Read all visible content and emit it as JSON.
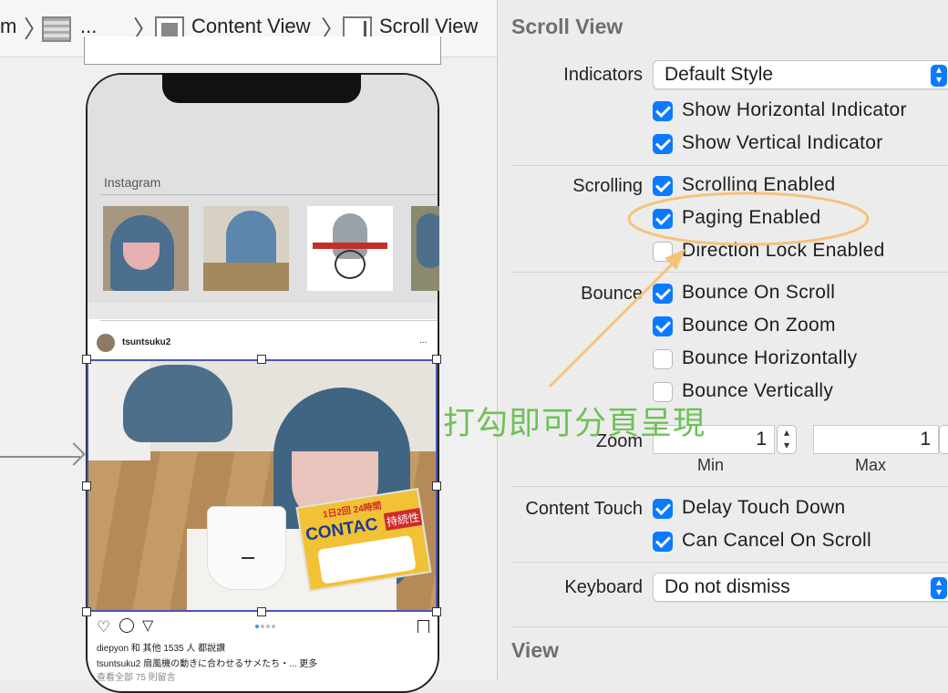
{
  "breadcrumb": {
    "items": [
      {
        "label": "m"
      },
      {
        "label": "..."
      },
      {
        "label": "Content View"
      },
      {
        "label": "Scroll View"
      }
    ]
  },
  "inspector": {
    "title": "Scroll View",
    "indicators": {
      "label": "Indicators",
      "value": "Default Style",
      "options": [
        {
          "label": "Show Horizontal Indicator",
          "checked": true
        },
        {
          "label": "Show Vertical Indicator",
          "checked": true
        }
      ]
    },
    "scrolling": {
      "label": "Scrolling",
      "options": [
        {
          "label": "Scrolling Enabled",
          "checked": true
        },
        {
          "label": "Paging Enabled",
          "checked": true
        },
        {
          "label": "Direction Lock Enabled",
          "checked": false
        }
      ]
    },
    "bounce": {
      "label": "Bounce",
      "options": [
        {
          "label": "Bounce On Scroll",
          "checked": true
        },
        {
          "label": "Bounce On Zoom",
          "checked": true
        },
        {
          "label": "Bounce Horizontally",
          "checked": false
        },
        {
          "label": "Bounce Vertically",
          "checked": false
        }
      ]
    },
    "zoom": {
      "label": "Zoom",
      "min_value": "1",
      "max_value": "1",
      "min_label": "Min",
      "max_label": "Max"
    },
    "content_touch": {
      "label": "Content Touch",
      "options": [
        {
          "label": "Delay Touch Down",
          "checked": true
        },
        {
          "label": "Can Cancel On Scroll",
          "checked": true
        }
      ]
    },
    "keyboard": {
      "label": "Keyboard",
      "value": "Do not dismiss"
    },
    "view_section": "View"
  },
  "annotation": {
    "text": "打勾即可分頁呈現",
    "highlight_color": "#f6c27a",
    "text_color": "#6fc05a"
  },
  "phone": {
    "section_title": "Instagram",
    "username": "tsuntsuku2",
    "more": "...",
    "likes": "diepyon 和 其他 1535 人 都說讚",
    "caption": "tsuntsuku2 扇風機の動きに合わせるサメたち・... 更多",
    "comments": "查看全部 75 則留言",
    "product_brand": "CONTAC",
    "product_badge": "持続性",
    "product_top": "1日2回 24時間"
  },
  "colors": {
    "accent": "#0a7aff",
    "selection_border": "#4b56b3"
  }
}
